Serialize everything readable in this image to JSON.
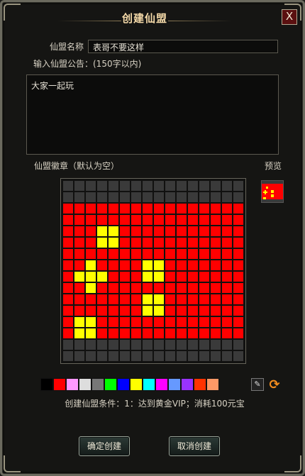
{
  "window": {
    "title": "创建仙盟",
    "close_label": "X"
  },
  "form": {
    "name_label": "仙盟名称",
    "name_value": "表哥不要这样",
    "notice_label": "输入仙盟公告：(150字以内)",
    "notice_value": "大家一起玩",
    "emblem_label": "仙盟徽章（默认为空）",
    "preview_label": "预览"
  },
  "emblem": {
    "size": 16,
    "colors": {
      "0": "#3a3a3a",
      "1": "#ff0000",
      "2": "#ffff00"
    },
    "rows": [
      "0000000000000000",
      "0000000000000000",
      "1111111111111111",
      "1111111111111111",
      "1112211111111111",
      "1112211111111111",
      "1111111111111111",
      "1121111221111111",
      "1222111221111111",
      "1121111111111111",
      "1111111221111111",
      "1111111221111111",
      "1221111111111111",
      "1221111111111111",
      "0000000000000000",
      "0000000000000000"
    ]
  },
  "palette": [
    "#000000",
    "#ff0000",
    "#ff99ff",
    "#dddddd",
    "#777777",
    "#00ff00",
    "#0000ff",
    "#ffff00",
    "#00ffff",
    "#ff00ff",
    "#6699ff",
    "#9933ff",
    "#ff3300",
    "#ff9966"
  ],
  "eraser_icon": "eraser-icon",
  "refresh_icon": "refresh-icon",
  "condition": "创建仙盟条件：1：达到黄金VIP；消耗100元宝",
  "buttons": {
    "confirm": "确定创建",
    "cancel": "取消创建"
  }
}
